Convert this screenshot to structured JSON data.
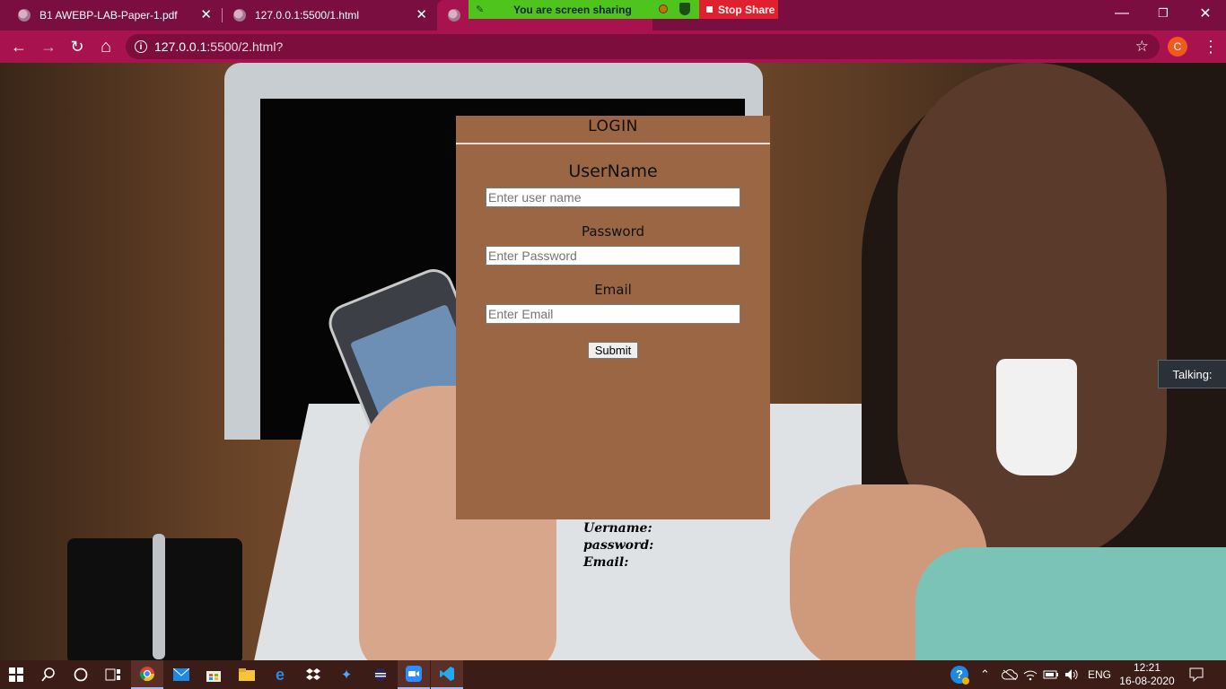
{
  "browser": {
    "tabs": [
      {
        "title": "B1 AWEBP-LAB-Paper-1.pdf",
        "close": "✕"
      },
      {
        "title": "127.0.0.1:5500/1.html",
        "close": "✕"
      }
    ],
    "share_banner": {
      "text": "You are screen sharing",
      "stop_label": "Stop Share"
    },
    "window_controls": {
      "minimize": "—",
      "maximize": "❐",
      "close": "✕"
    },
    "nav": {
      "back": "←",
      "forward": "→",
      "reload": "↻",
      "home": "⌂"
    },
    "address": {
      "host": "127.0.0.1",
      "path": ":5500/2.html?"
    },
    "profile_initial": "C",
    "bookmark_star": "☆",
    "menu": "⋮"
  },
  "login": {
    "title": "LOGIN",
    "username_label": "UserName",
    "username_placeholder": "Enter user name",
    "password_label": "Password",
    "password_placeholder": "Enter Password",
    "email_label": "Email",
    "email_placeholder": "Enter Email",
    "submit_label": "Submit"
  },
  "output": {
    "username_label": "Uername:",
    "password_label": "password:",
    "email_label": "Email:"
  },
  "talking": {
    "label": "Talking:"
  },
  "taskbar": {
    "language": "ENG",
    "time": "12:21",
    "date": "16-08-2020",
    "icons": [
      "windows-start-icon",
      "search-icon",
      "cortana-icon",
      "task-view-icon",
      "chrome-icon",
      "mail-icon",
      "store-icon",
      "file-explorer-icon",
      "edge-icon",
      "dropbox-icon",
      "vs-icon",
      "eclipse-icon",
      "zoom-icon",
      "vscode-icon"
    ]
  },
  "colors": {
    "chrome_accent": "#a8124f",
    "card_bg": "#9b6644",
    "share_green": "#4fc41d",
    "stop_red": "#e0202e"
  }
}
